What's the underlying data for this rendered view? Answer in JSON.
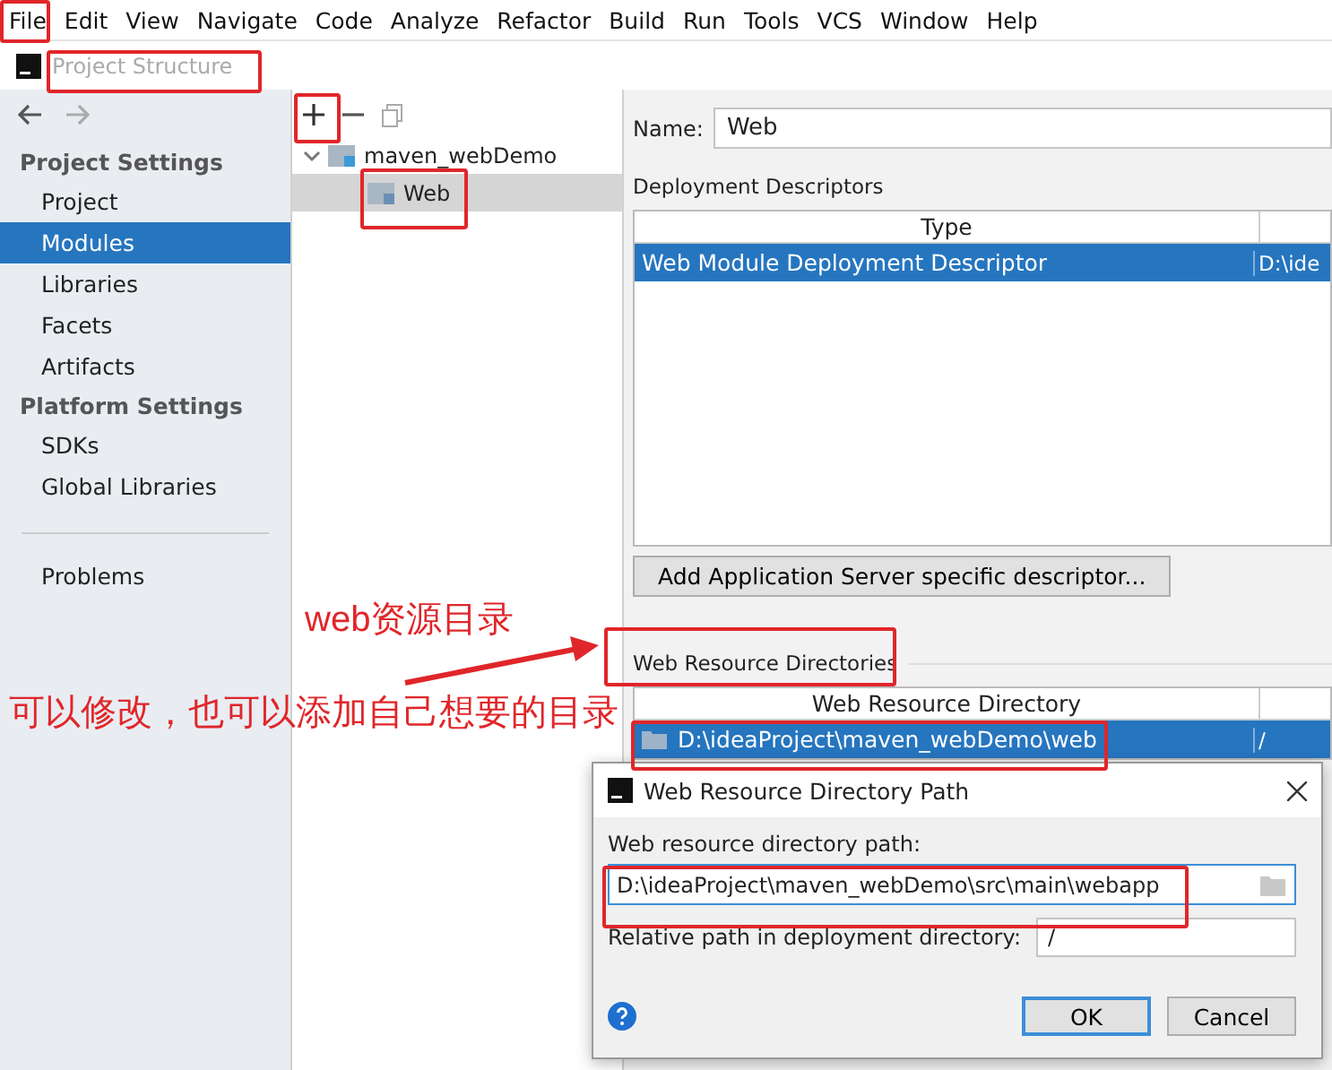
{
  "menu_bar": [
    "File",
    "Edit",
    "View",
    "Navigate",
    "Code",
    "Analyze",
    "Refactor",
    "Build",
    "Run",
    "Tools",
    "VCS",
    "Window",
    "Help"
  ],
  "window": {
    "title": "Project Structure"
  },
  "sidebar": {
    "sections": [
      {
        "heading": "Project Settings",
        "items": [
          {
            "label": "Project",
            "selected": false
          },
          {
            "label": "Modules",
            "selected": true
          },
          {
            "label": "Libraries",
            "selected": false
          },
          {
            "label": "Facets",
            "selected": false
          },
          {
            "label": "Artifacts",
            "selected": false
          }
        ]
      },
      {
        "heading": "Platform Settings",
        "items": [
          {
            "label": "SDKs",
            "selected": false
          },
          {
            "label": "Global Libraries",
            "selected": false
          }
        ]
      }
    ],
    "footer_items": [
      {
        "label": "Problems",
        "selected": false
      }
    ]
  },
  "tree": {
    "items": [
      {
        "label": "maven_webDemo",
        "expanded": true,
        "selected": false,
        "children": [
          {
            "label": "Web",
            "selected": true
          }
        ]
      }
    ]
  },
  "module": {
    "name_label": "Name:",
    "name_value": "Web",
    "descriptors": {
      "title": "Deployment Descriptors",
      "columns": [
        "Type"
      ],
      "rows": [
        {
          "cells": [
            "Web Module Deployment Descriptor",
            "D:\\ide"
          ],
          "selected": true
        }
      ]
    },
    "add_button": "Add Application Server specific descriptor...",
    "resources": {
      "title": "Web Resource Directories",
      "columns": [
        "Web Resource Directory"
      ],
      "rows": [
        {
          "cells": [
            "D:\\ideaProject\\maven_webDemo\\web",
            "/"
          ],
          "selected": true
        }
      ]
    }
  },
  "dialog": {
    "title": "Web Resource Directory Path",
    "path_label": "Web resource directory path:",
    "path_value": "D:\\ideaProject\\maven_webDemo\\src\\main\\webapp",
    "relative_label": "Relative path in deployment directory:",
    "relative_value": "/",
    "buttons": [
      {
        "label": "OK",
        "default": true
      },
      {
        "label": "Cancel",
        "default": false
      }
    ]
  },
  "annotations": [
    "web资源目录",
    "可以修改，也可以添加自己想要的目录"
  ]
}
